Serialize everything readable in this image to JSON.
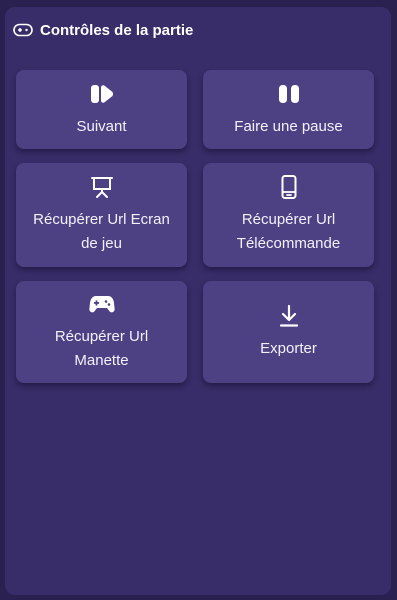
{
  "panel": {
    "title": "Contrôles de la partie",
    "title_icon": "gamepad-outline-icon"
  },
  "controls": [
    {
      "label": "Suivant",
      "icon": "skip-next-icon"
    },
    {
      "label": "Faire une pause",
      "icon": "pause-icon"
    },
    {
      "label": "Récupérer Url Ecran de jeu",
      "icon": "presentation-screen-icon"
    },
    {
      "label": "Récupérer Url Télécommande",
      "icon": "mobile-phone-icon"
    },
    {
      "label": "Récupérer Url Manette",
      "icon": "gamepad-icon"
    },
    {
      "label": "Exporter",
      "icon": "download-icon"
    }
  ],
  "colors": {
    "background": "#2b2150",
    "panel": "#392d69",
    "button": "#4e4183",
    "text": "#ffffff"
  }
}
